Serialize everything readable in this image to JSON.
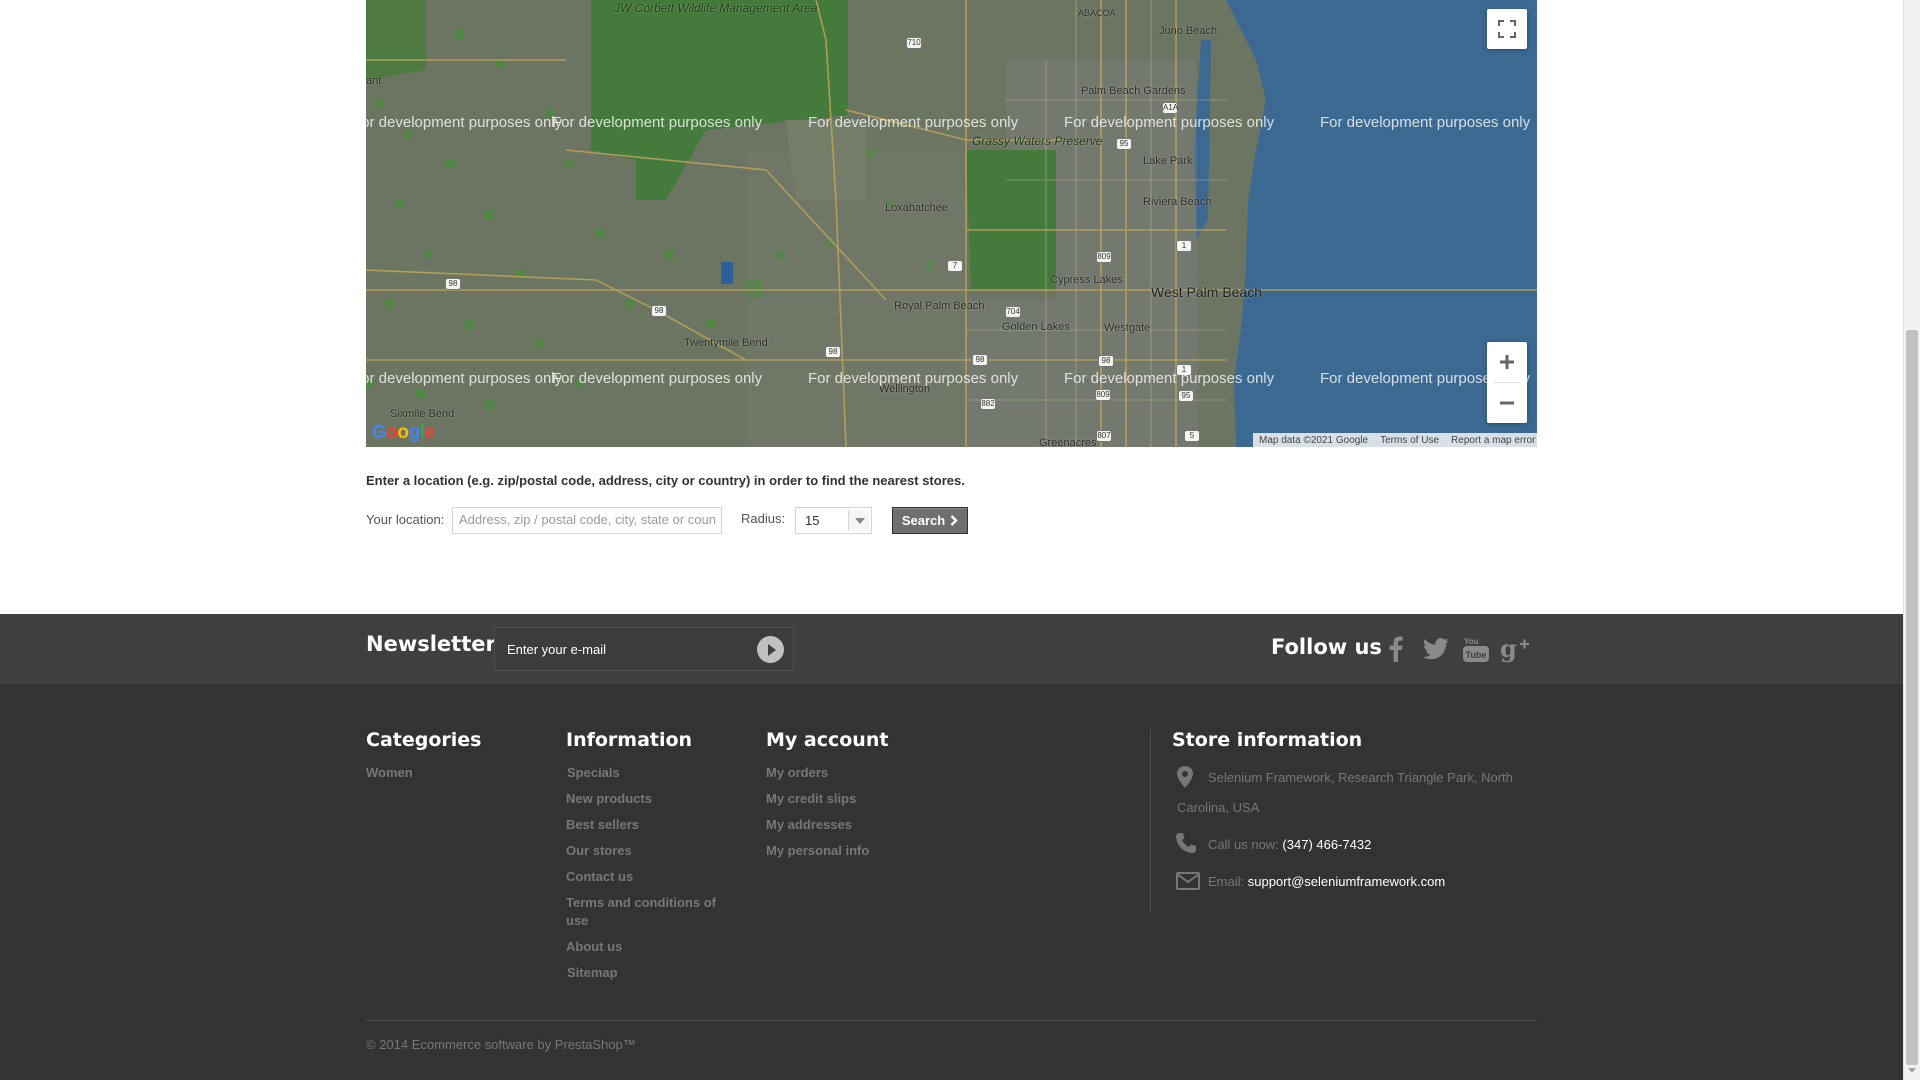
{
  "map": {
    "dev_watermark": "For development purposes only",
    "labels": {
      "jw_corbett": "JW Corbett Wildlife Management Area",
      "juno_beach": "Juno Beach",
      "abacoa": "ABACOA",
      "palm_beach_gardens": "Palm Beach Gardens",
      "grassy_waters": "Grassy Waters Preserve",
      "lake_park": "Lake Park",
      "riviera_beach": "Riviera Beach",
      "loxahatchee": "Loxahatchee",
      "cypress_lakes": "Cypress Lakes",
      "west_palm_beach": "West Palm Beach",
      "royal_palm_beach": "Royal Palm Beach",
      "golden_lakes": "Golden Lakes",
      "westgate": "Westgate",
      "twentymile_bend": "Twentymile Bend",
      "wellington": "Wellington",
      "sixmile_bend": "Sixmile Bend",
      "greenacres": "Greenacres",
      "grant": "ant"
    },
    "google_logo": "Google",
    "attribution": {
      "data": "Map data ©2021 Google",
      "terms": "Terms of Use",
      "report": "Report a map error"
    },
    "controls": {
      "fullscreen": "fullscreen-icon",
      "zoom_in": "plus-icon",
      "zoom_out": "minus-icon"
    }
  },
  "locator": {
    "intro": "Enter a location (e.g. zip/postal code, address, city or country) in order to find the nearest stores.",
    "location_label": "Your location:",
    "location_placeholder": "Address, zip / postal code, city, state or coun",
    "radius_label": "Radius:",
    "radius_value": "15",
    "search_label": "Search"
  },
  "newsletter": {
    "title": "Newsletter",
    "input_value": "Enter your e-mail"
  },
  "follow": {
    "title": "Follow us",
    "icons": [
      "facebook-icon",
      "twitter-icon",
      "youtube-icon",
      "google-plus-icon"
    ]
  },
  "footer": {
    "categories": {
      "title": "Categories",
      "links": [
        "Women"
      ]
    },
    "information": {
      "title": "Information",
      "links": [
        "Specials",
        "New products",
        "Best sellers",
        "Our stores",
        "Contact us",
        "Terms and conditions of",
        "use",
        "About us",
        "Sitemap"
      ]
    },
    "account": {
      "title": "My account",
      "links": [
        "My orders",
        "My credit slips",
        "My addresses",
        "My personal info"
      ]
    },
    "store": {
      "title": "Store information",
      "address_line1": "Selenium Framework, Research Triangle Park, North",
      "address_line2": "Carolina, USA",
      "call_label": "Call us now: ",
      "phone": "(347) 466-7432",
      "email_label": "Email: ",
      "email": "support@seleniumframework.com"
    },
    "copyright": "© 2014 Ecommerce software by PrestaShop™"
  },
  "colors": {
    "footer_bg": "#333333",
    "band_bg": "#3f3f3f",
    "ocean": "#3b6992",
    "land": "#6c7561",
    "park": "#447a3c"
  }
}
